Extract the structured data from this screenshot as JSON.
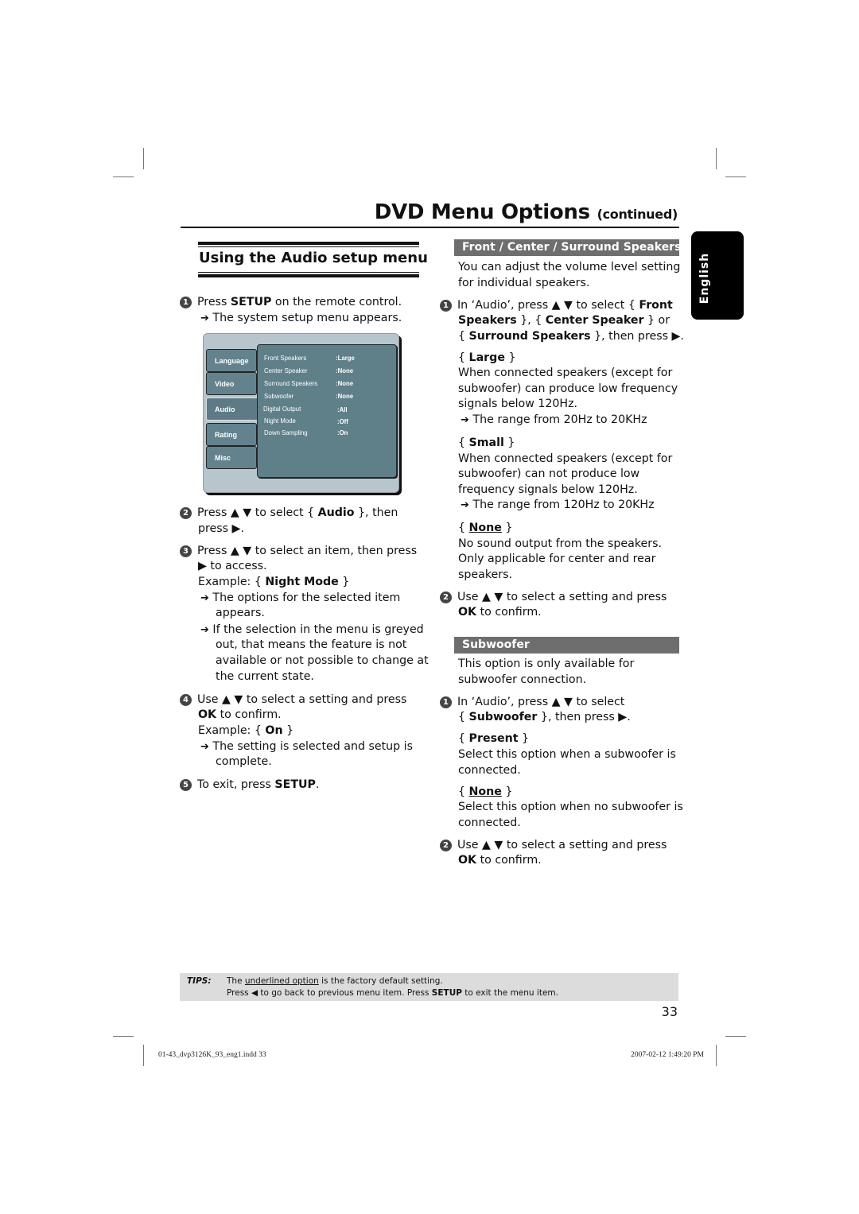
{
  "header": {
    "title": "DVD Menu Options",
    "continued": "(continued)"
  },
  "language_tab": "English",
  "left": {
    "section_title": "Using the Audio setup menu",
    "step1": {
      "num": "1",
      "pre": "Press ",
      "bold": "SETUP",
      "post": " on the remote control.",
      "result": "The system setup menu appears."
    },
    "menu": {
      "tabs": [
        "Language",
        "Video",
        "Audio",
        "Rating",
        "Misc"
      ],
      "active_tab": "Audio",
      "items": [
        {
          "label": "Front Speakers",
          "value": ":Large"
        },
        {
          "label": "Center Speaker",
          "value": ":None"
        },
        {
          "label": "Surround Speakers",
          "value": ":None"
        },
        {
          "label": "Subwoofer",
          "value": ":None"
        },
        {
          "label": "Digital Output",
          "value": ":All"
        },
        {
          "label": "Night  Mode",
          "value": ":Off"
        },
        {
          "label": "Down Sampling",
          "value": ":On"
        }
      ]
    },
    "step2": {
      "num": "2",
      "line1_pre": "Press ▲ ▼ to select { ",
      "line1_bold": "Audio",
      "line1_post": " }, then",
      "line2": "press ▶."
    },
    "step3": {
      "num": "3",
      "line1": "Press ▲ ▼ to select an item, then press",
      "line2": "▶ to access.",
      "example_pre": "Example: { ",
      "example_bold": "Night Mode",
      "example_post": " }",
      "result1_l1": "The options for the selected item",
      "result1_l2": "appears.",
      "result2_l1": "If the selection in the menu is greyed",
      "result2_l2": "out, that means the feature is not",
      "result2_l3": "available or not possible to change at",
      "result2_l4": "the current state."
    },
    "step4": {
      "num": "4",
      "line1": "Use ▲ ▼ to select a setting and press",
      "line2_bold": "OK",
      "line2_post": " to confirm.",
      "example_pre": "Example: { ",
      "example_bold": "On",
      "example_post": " }",
      "result_l1": "The setting is selected and setup is",
      "result_l2": "complete."
    },
    "step5": {
      "num": "5",
      "pre": "To exit, press ",
      "bold": "SETUP",
      "post": "."
    }
  },
  "right": {
    "speakers": {
      "banner": "Front / Center / Surround Speakers",
      "intro_l1": "You can adjust the volume level setting",
      "intro_l2": "for individual speakers.",
      "step1": {
        "num": "1",
        "l1_pre": "In ‘Audio’, press ▲ ▼ to select { ",
        "l1_bold": "Front",
        "l2_bold1": "Speakers",
        "l2_mid": " }, { ",
        "l2_bold2": "Center Speaker",
        "l2_post": " } or",
        "l3_pre": "{ ",
        "l3_bold": "Surround Speakers",
        "l3_post": " }, then press ▶."
      },
      "options": [
        {
          "name": "Large",
          "underlined": false,
          "lines": [
            "When connected speakers (except for",
            "subwoofer) can produce low frequency",
            "signals below 120Hz."
          ],
          "result": "The range from 20Hz to 20KHz"
        },
        {
          "name": "Small",
          "underlined": false,
          "lines": [
            "When connected speakers (except for",
            "subwoofer) can not produce low",
            "frequency signals below 120Hz."
          ],
          "result": "The range from 120Hz to 20KHz"
        },
        {
          "name": "None",
          "underlined": true,
          "lines": [
            "No sound output from the speakers.",
            "Only applicable for center and rear",
            "speakers."
          ],
          "result": ""
        }
      ],
      "step2": {
        "num": "2",
        "line1": "Use ▲ ▼ to select a setting and press",
        "line2_bold": "OK",
        "line2_post": " to confirm."
      }
    },
    "subwoofer": {
      "banner": "Subwoofer",
      "intro_l1": "This option is only available for",
      "intro_l2": "subwoofer connection.",
      "step1": {
        "num": "1",
        "l1": "In ‘Audio’, press ▲ ▼ to select",
        "l2_pre": "{ ",
        "l2_bold": "Subwoofer",
        "l2_post": " }, then press ▶."
      },
      "options": [
        {
          "name": "Present",
          "underlined": false,
          "lines": [
            "Select this option when a subwoofer is",
            "connected."
          ]
        },
        {
          "name": "None",
          "underlined": true,
          "lines": [
            "Select this option when no subwoofer is",
            "connected."
          ]
        }
      ],
      "step2": {
        "num": "2",
        "line1": "Use ▲ ▼ to select a setting and press",
        "line2_bold": "OK",
        "line2_post": " to confirm."
      }
    }
  },
  "tips": {
    "label": "TIPS:",
    "line1_pre": "The ",
    "line1_underlined": "underlined option",
    "line1_post": " is the factory default setting.",
    "line2_pre": "Press  ◀ to go back to previous menu item. Press ",
    "line2_bold": "SETUP",
    "line2_post": " to exit the menu item."
  },
  "page_number": "33",
  "footer": {
    "file": "01-43_dvp3126K_93_eng1.indd   33",
    "timestamp": "2007-02-12   1:49:20 PM"
  }
}
